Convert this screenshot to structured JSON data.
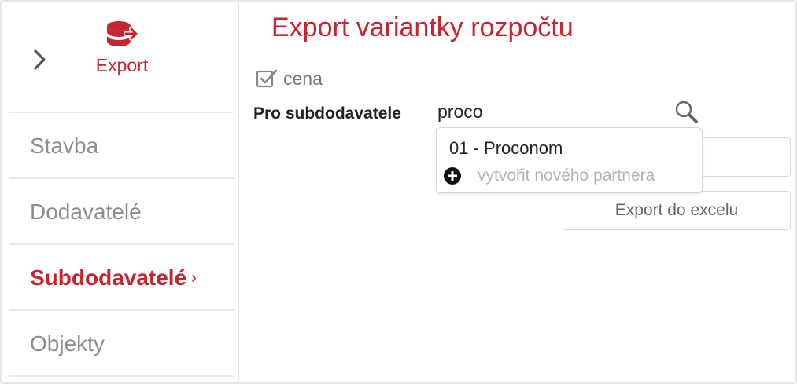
{
  "sidebar": {
    "export_label": "Export",
    "items": [
      {
        "label": "Stavba"
      },
      {
        "label": "Dodavatelé"
      },
      {
        "label": "Subdodavatelé",
        "arrow": "›"
      },
      {
        "label": "Objekty"
      }
    ]
  },
  "main": {
    "title": "Export variantky rozpočtu",
    "checkbox_label": "cena",
    "field_label": "Pro subdodavatele",
    "search_value": "proco",
    "export_button_label": "Export do excelu",
    "dropdown": {
      "option": "01 - Proconom",
      "create_label": "vytvořit nového partnera"
    }
  },
  "colors": {
    "accent": "#c8242f",
    "muted_text": "#8d8d8d",
    "border": "#e8e8e8"
  },
  "icons": [
    "chevron-right-icon",
    "database-export-icon",
    "checkbox-checked-icon",
    "search-icon",
    "plus-circle-icon"
  ]
}
